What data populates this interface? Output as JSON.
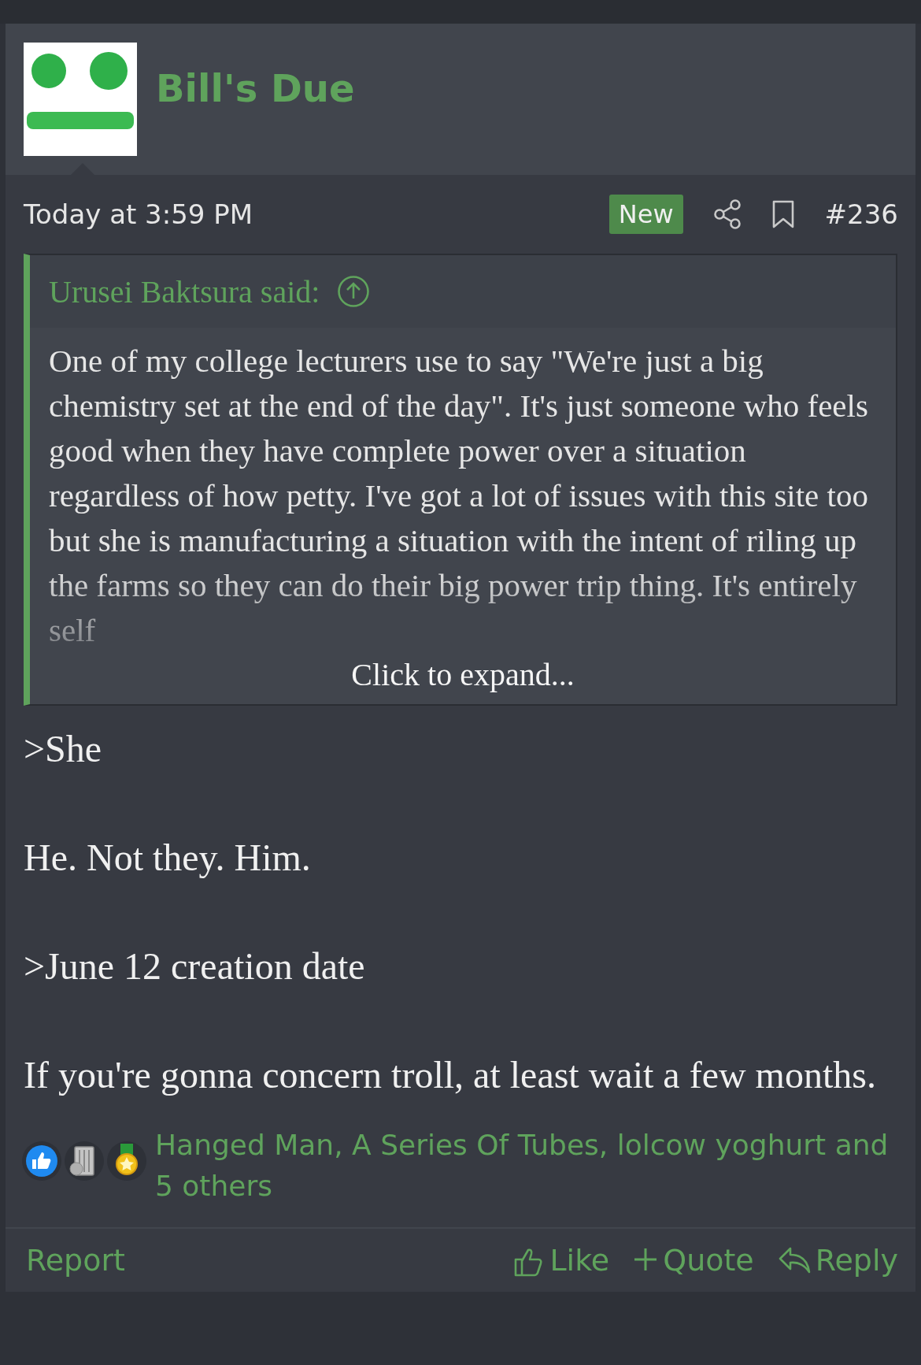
{
  "poster": {
    "name": "Bill's Due"
  },
  "post": {
    "time": "Today at 3:59 PM",
    "is_new": true,
    "new_badge": "New",
    "bookmarked": false,
    "number": "#236"
  },
  "quote": {
    "author_line": "Urusei Baktsura said:",
    "text": "One of my college lecturers use to say \"We're just a big chemistry set at the end of the day\". It's just someone who feels good when they have complete power over a situation regardless of how petty. I've got a lot of issues with this site too but she is manufacturing a situation with the intent of riling up the farms so they can do their big power trip thing. It's entirely self",
    "expand_label": "Click to expand..."
  },
  "body": {
    "paragraphs": [
      ">She",
      "He. Not they. Him.",
      ">June 12 creation date",
      "If you're gonna concern troll, at least wait a few months."
    ]
  },
  "reactions": {
    "icons": [
      {
        "kind": "like"
      },
      {
        "kind": "trash"
      },
      {
        "kind": "medal"
      }
    ],
    "summary": "Hanged Man, A Series Of Tubes, lolcow yoghurt and 5 others"
  },
  "actions": {
    "report": "Report",
    "buttons": [
      {
        "kind": "like",
        "label": "Like"
      },
      {
        "kind": "quote",
        "label": "Quote"
      },
      {
        "kind": "reply",
        "label": "Reply"
      }
    ]
  }
}
